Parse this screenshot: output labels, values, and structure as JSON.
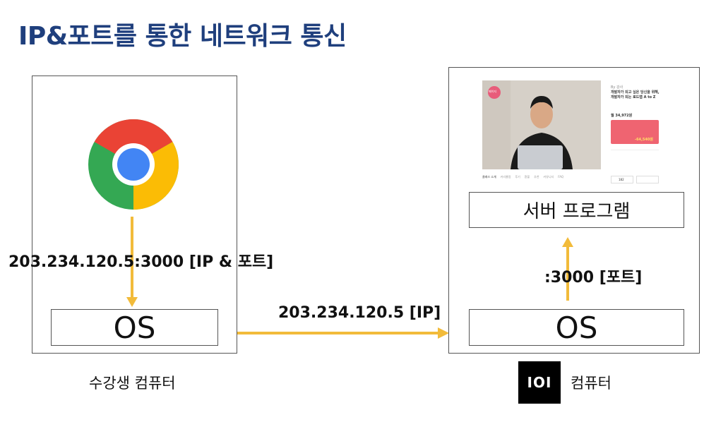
{
  "title": "IP&포트를 통한 네트워크 통신",
  "student": {
    "os_label": "OS",
    "caption": "수강생 컴퓨터",
    "browser_icon": "chrome-icon",
    "arrow_label": "203.234.120.5:3000 [IP & 포트]"
  },
  "network": {
    "arrow_label": "203.234.120.5 [IP]"
  },
  "server": {
    "program_label": "서버 프로그램",
    "os_label": "OS",
    "arrow_label": ":3000 [포트]",
    "logo_text": "IOI",
    "caption": "컴퓨터"
  },
  "thumbnail": {
    "badge": "페이지",
    "byline": "By 강사",
    "headline": "개발자가 되고 싶은 당신을 위해, 개발자가 되는 로드맵 A to Z",
    "price": "월 34,972원",
    "promo": "-64,540원",
    "tabs": [
      "클래스 소개",
      "커리큘럼",
      "후기",
      "환불",
      "추천",
      "커뮤니티",
      "FAQ"
    ],
    "like_count": "182"
  },
  "colors": {
    "title": "#1f3f7d",
    "arrow": "#f2bb3a",
    "frame": "#555555"
  }
}
